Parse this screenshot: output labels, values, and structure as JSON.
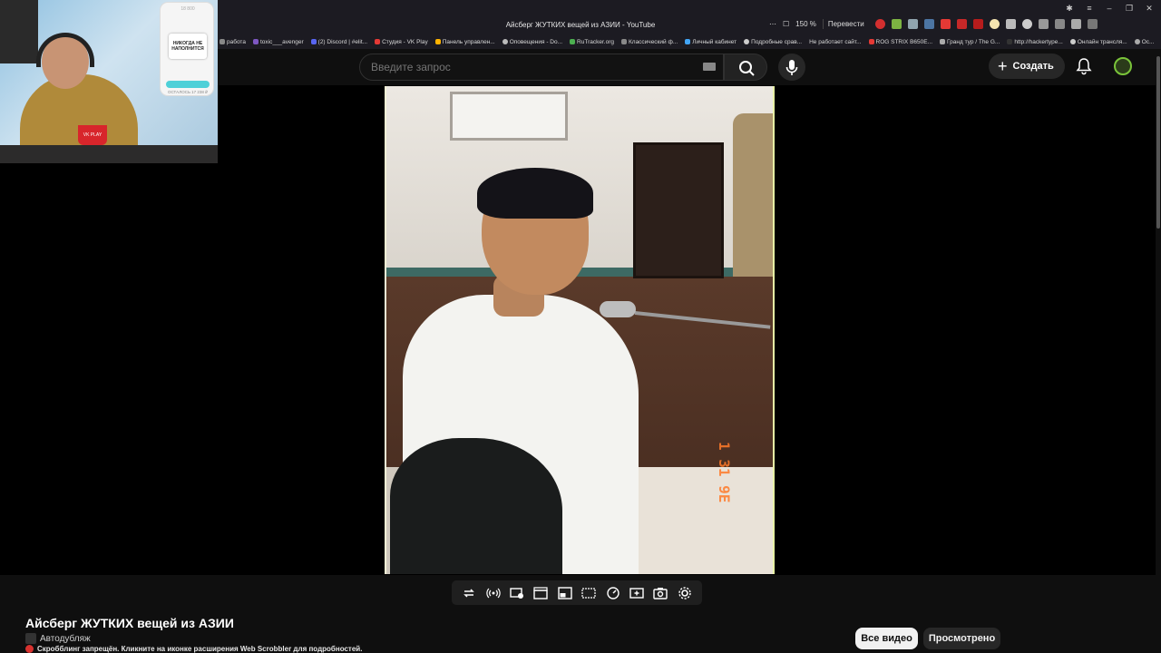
{
  "browser": {
    "window_title": "Айсберг ЖУТКИХ вещей из АЗИИ - YouTube",
    "zoom": "150 %",
    "translate_label": "Перевести",
    "bookmarks": [
      "работа",
      "toxic___avenger",
      "(2) Discord | #elit...",
      "Студия - VK Play",
      "Панель управлен...",
      "Оповещения - Do...",
      "RuTracker.org",
      "Классический ф...",
      "Личный кабинет",
      "Подробные срав...",
      "Не работает сайт...",
      "ROG STRIX B650E...",
      "Гранд тур / The G...",
      "http://hackertype...",
      "Онлайн трансля...",
      "Ос..."
    ]
  },
  "youtube": {
    "search_placeholder": "Введите запрос",
    "create_label": "Создать",
    "video_title": "Айсберг ЖУТКИХ вещей из АЗИИ",
    "channel_label": "Автодубляж",
    "scrobbler_notice": "Скробблинг запрещён. Кликните на иконке расширения Web Scrobbler для подробностей.",
    "chips": [
      "Все видео",
      "Просмотрено"
    ],
    "video_date_stamp": "1 31 9E"
  },
  "webcam": {
    "phone_top": "18 800",
    "phone_card": "НИКОГДА НЕ НАПОЛНИТСЯ",
    "phone_bottom": "ОСТАЛОСЬ 17 238 ₽",
    "cup_label": "VK PLAY"
  },
  "colors": {
    "accent_red": "#d8322f",
    "chip_active_bg": "#f1f1f1",
    "background": "#0f0f0f"
  },
  "icons": {
    "toolbar": [
      "loop-icon",
      "broadcast-icon",
      "playlist-video-icon",
      "clapper-icon",
      "picture-in-picture-icon",
      "subtitles-icon",
      "speed-icon",
      "add-video-icon",
      "screenshot-icon",
      "settings-icon"
    ]
  }
}
